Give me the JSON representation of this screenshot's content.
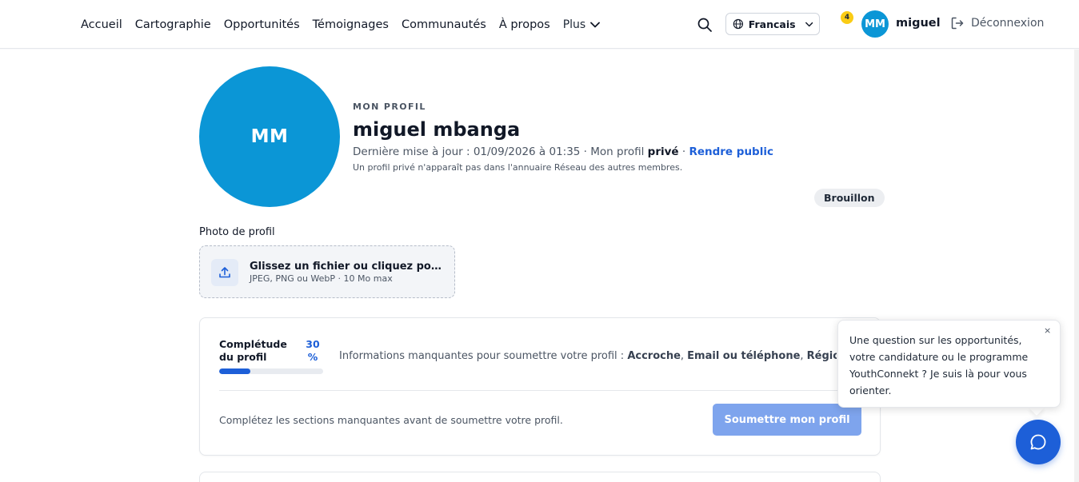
{
  "nav": {
    "items": [
      "Accueil",
      "Cartographie",
      "Opportunités",
      "Témoignages",
      "Communautés",
      "À propos"
    ],
    "more_label": "Plus"
  },
  "header": {
    "language": "Francais",
    "notification_count": "4",
    "avatar_initials": "MM",
    "username": "miguel",
    "logout_label": "Déconnexion"
  },
  "profile": {
    "eyebrow": "MON PROFIL",
    "initials": "MM",
    "name": "miguel mbanga",
    "updated_prefix": "Dernière mise à jour : 01/09/2026 à 01:35 · Mon profil ",
    "visibility": "privé",
    "separator": " · ",
    "make_public": "Rendre public",
    "privacy_hint": "Un profil privé n'apparaît pas dans l'annuaire Réseau des autres membres.",
    "status_badge": "Brouillon"
  },
  "photo": {
    "label": "Photo de profil",
    "drop_title": "Glissez un fichier ou cliquez pour …",
    "drop_subtitle": "JPEG, PNG ou WebP · 10 Mo max"
  },
  "completion": {
    "label": "Complétude du profil",
    "percent_value": "30",
    "percent_sign": "%",
    "progress": 0.3,
    "missing_prefix": "Informations manquantes pour soumettre votre profil : ",
    "missing_items": [
      "Accroche",
      "Email ou téléphone",
      "Région"
    ],
    "submit_hint": "Complétez les sections manquantes avant de soumettre votre profil.",
    "submit_label": "Soumettre mon profil"
  },
  "chat": {
    "message": "Une question sur les opportunités, votre candidature ou le programme YouthConnekt ? Je suis là pour vous orienter.",
    "close": "×"
  },
  "colors": {
    "accent": "#1d5fd8",
    "avatar": "#0b96d6",
    "notification": "#facc15",
    "submit_disabled": "#7ea4ed"
  },
  "icons": [
    "search-icon",
    "globe-icon",
    "chevron-down-icon",
    "logout-icon",
    "upload-icon",
    "chat-icon",
    "close-icon"
  ]
}
